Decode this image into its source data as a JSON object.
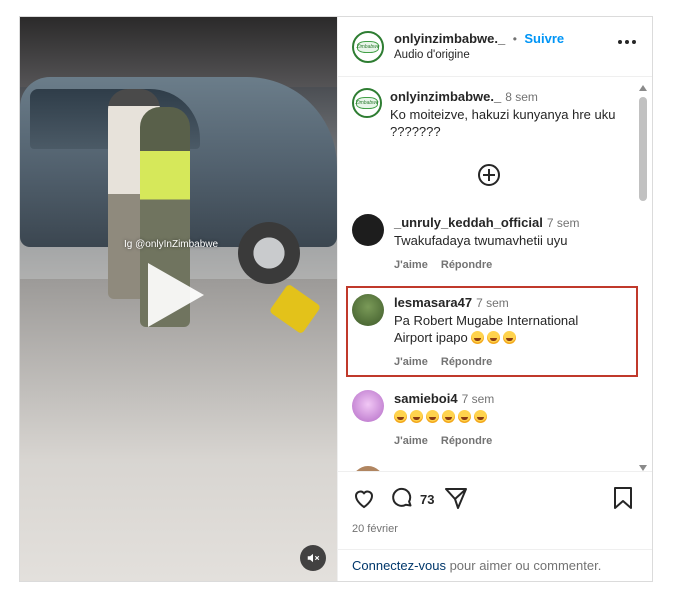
{
  "post": {
    "username": "onlyinzimbabwe._",
    "separator": "•",
    "follow_label": "Suivre",
    "audio": "Audio d'origine",
    "avatar_text": "Zimbabwe"
  },
  "video": {
    "watermark": "Ig @onlyInZimbabwe"
  },
  "caption": {
    "username": "onlyinzimbabwe._",
    "time": "8 sem",
    "text": "Ko moiteizve, hakuzi kunyanya hre uku ???????"
  },
  "comments": [
    {
      "username": "_unruly_keddah_official",
      "time": "7 sem",
      "text": "Twakufadaya twumavhetii uyu",
      "like_label": "J'aime",
      "reply_label": "Répondre",
      "avatar_color": "#1d1d1d"
    },
    {
      "username": "lesmasara47",
      "time": "7 sem",
      "text": "Pa Robert Mugabe International Airport ipapo",
      "emojis": 3,
      "like_label": "J'aime",
      "reply_label": "Répondre",
      "avatar_color": "#4f6b3a"
    },
    {
      "username": "samieboi4",
      "time": "7 sem",
      "text": "",
      "emojis": 6,
      "like_label": "J'aime",
      "reply_label": "Répondre",
      "avatar_color": "#c98bd8"
    }
  ],
  "footer": {
    "comment_count": "73",
    "date": "20 février",
    "login_link": "Connectez-vous",
    "login_text": " pour aimer ou commenter."
  },
  "colors": {
    "follow": "#0095f6",
    "highlight_border": "#c0392b"
  }
}
